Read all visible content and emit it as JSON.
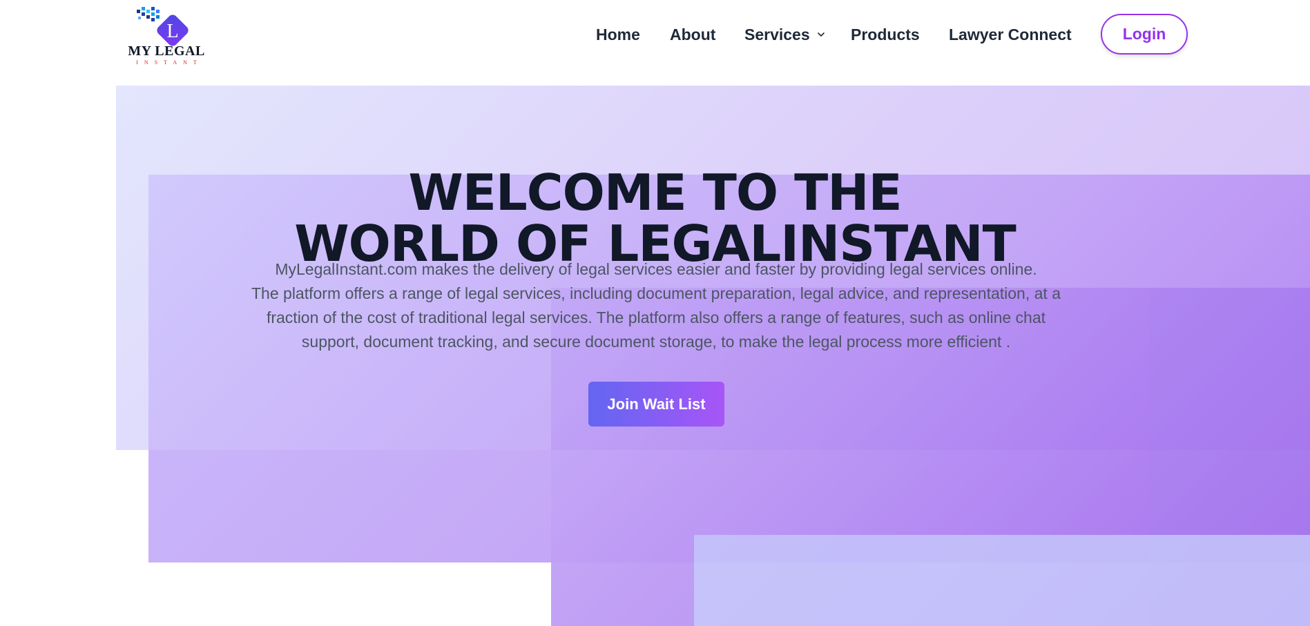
{
  "logo": {
    "initial": "L",
    "word": "MY LEGAL",
    "sub": "INSTANT",
    "icon": "logo-icon"
  },
  "nav": {
    "home": "Home",
    "about": "About",
    "services": "Services",
    "products": "Products",
    "lawyer_connect": "Lawyer Connect",
    "login": "Login",
    "services_icon": "chevron-down-icon"
  },
  "hero": {
    "title_line1": "WELCOME TO THE",
    "title_line2": "WORLD OF LEGALINSTANT",
    "description_line1": "MyLegalInstant.com makes the delivery of legal services easier and faster by providing legal services online.",
    "description_line2": "The platform offers a range of legal services, including document preparation, legal advice, and representation, at a",
    "description_line3": "fraction of the cost of traditional legal services. The platform also offers a range of features, such as online chat",
    "description_line4": "support, document tracking, and secure document storage, to make the legal process more efficient .",
    "cta": "Join Wait List"
  },
  "colors": {
    "accent": "#9333ea",
    "cta_start": "#6366f1",
    "cta_end": "#a855f7",
    "heading": "#111827",
    "body_text": "#4b5563"
  }
}
